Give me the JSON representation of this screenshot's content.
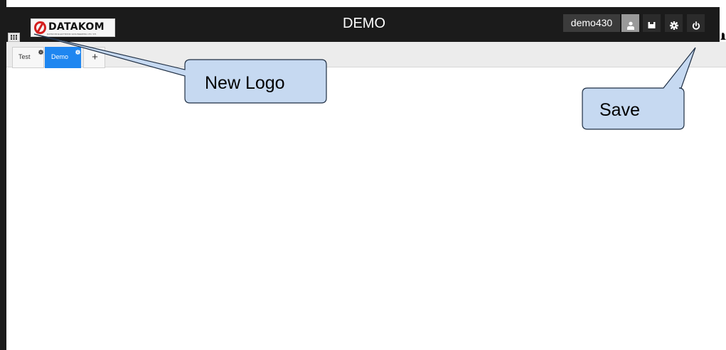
{
  "header": {
    "logo_text": "DATAKOM",
    "logo_subtext": "DATAKOM ELECTRONIC ENGINEERING LTD. STI.",
    "title": "DEMO",
    "username": "demo430"
  },
  "header_buttons": [
    {
      "name": "user-icon"
    },
    {
      "name": "save-icon"
    },
    {
      "name": "gear-icon"
    },
    {
      "name": "power-icon"
    }
  ],
  "tabs": [
    {
      "label": "Test",
      "active": false
    },
    {
      "label": "Demo",
      "active": true
    }
  ],
  "add_tab_label": "+",
  "annotations": {
    "logo_callout": "New Logo",
    "save_callout": "Save"
  },
  "colors": {
    "header_bg": "#1b1b1b",
    "active_tab": "#1e86f0",
    "callout_fill": "#c6d9f1"
  }
}
